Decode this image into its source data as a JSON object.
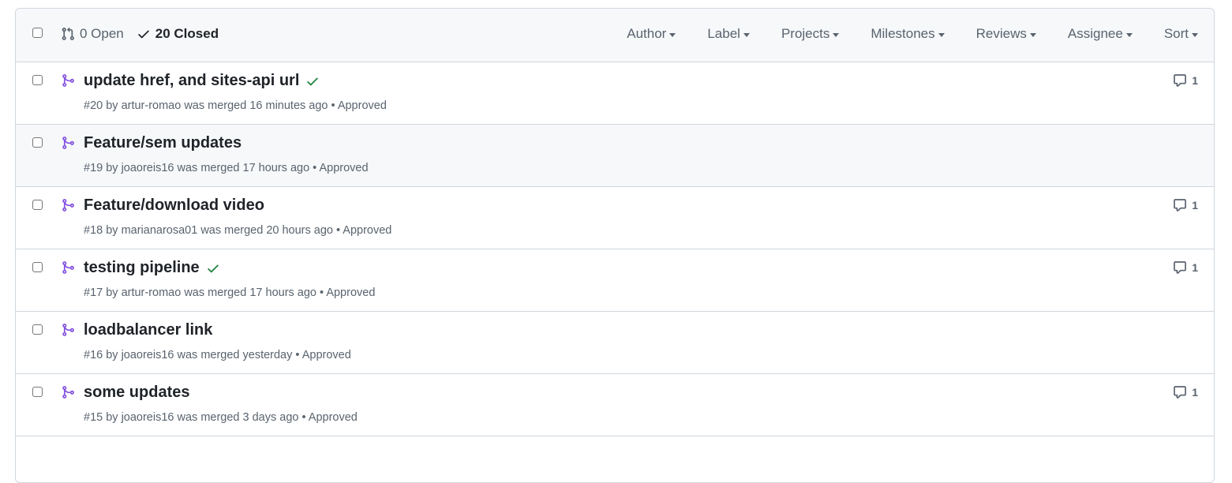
{
  "header": {
    "open_label": "0 Open",
    "closed_label": "20 Closed",
    "filters": [
      "Author",
      "Label",
      "Projects",
      "Milestones",
      "Reviews",
      "Assignee",
      "Sort"
    ]
  },
  "colors": {
    "merged": "#8250df",
    "success": "#1a7f37",
    "muted": "#59636e",
    "border": "#d0d7de"
  },
  "pull_requests": [
    {
      "title": "update href, and sites-api url",
      "check": true,
      "meta": "#20 by artur-romao was merged 16 minutes ago • Approved",
      "comments": "1"
    },
    {
      "title": "Feature/sem updates",
      "check": false,
      "meta": "#19 by joaoreis16 was merged 17 hours ago • Approved",
      "comments": null
    },
    {
      "title": "Feature/download video",
      "check": false,
      "meta": "#18 by marianarosa01 was merged 20 hours ago • Approved",
      "comments": "1"
    },
    {
      "title": "testing pipeline",
      "check": true,
      "meta": "#17 by artur-romao was merged 17 hours ago • Approved",
      "comments": "1"
    },
    {
      "title": "loadbalancer link",
      "check": false,
      "meta": "#16 by joaoreis16 was merged yesterday • Approved",
      "comments": null
    },
    {
      "title": "some updates",
      "check": false,
      "meta": "#15 by joaoreis16 was merged 3 days ago • Approved",
      "comments": "1"
    }
  ]
}
